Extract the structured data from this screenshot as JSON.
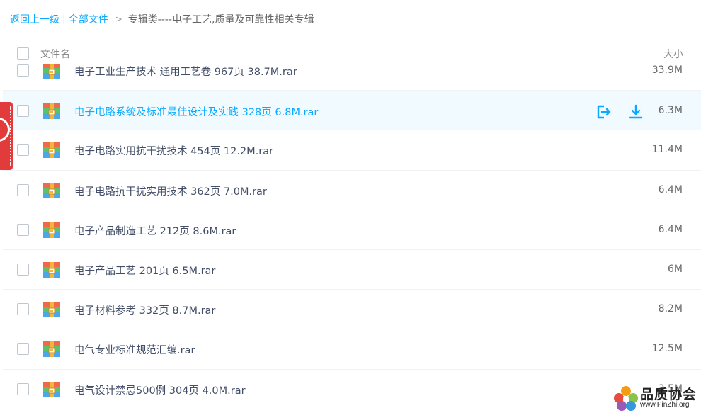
{
  "breadcrumb": {
    "back": "返回上一级",
    "separator": "|",
    "all_files": "全部文件",
    "arrow": ">",
    "current": "专辑类----电子工艺,质量及可靠性相关专辑"
  },
  "header": {
    "name_label": "文件名",
    "size_label": "大小"
  },
  "files": [
    {
      "name": "电子工业生产技术 通用工艺卷 967页 38.7M.rar",
      "size": "33.9M"
    },
    {
      "name": "电子电路系统及标准最佳设计及实践 328页 6.8M.rar",
      "size": "6.3M"
    },
    {
      "name": "电子电路实用抗干扰技术 454页 12.2M.rar",
      "size": "11.4M"
    },
    {
      "name": "电子电路抗干扰实用技术 362页 7.0M.rar",
      "size": "6.4M"
    },
    {
      "name": "电子产品制造工艺 212页 8.6M.rar",
      "size": "6.4M"
    },
    {
      "name": "电子产品工艺 201页 6.5M.rar",
      "size": "6M"
    },
    {
      "name": "电子材料参考 332页 8.7M.rar",
      "size": "8.2M"
    },
    {
      "name": "电气专业标准规范汇编.rar",
      "size": "12.5M"
    },
    {
      "name": "电气设计禁忌500例 304页 4.0M.rar",
      "size": "3.5M"
    }
  ],
  "row_actions": {
    "share_icon": "share-icon",
    "download_icon": "download-icon"
  },
  "file_icon": "rar-archive-icon",
  "colors": {
    "accent": "#09aaff",
    "highlight_row": "#f0faff",
    "side_tab": "#e23b3b"
  },
  "watermark": {
    "name": "品质协会",
    "url": "www.PinZhi.org"
  }
}
